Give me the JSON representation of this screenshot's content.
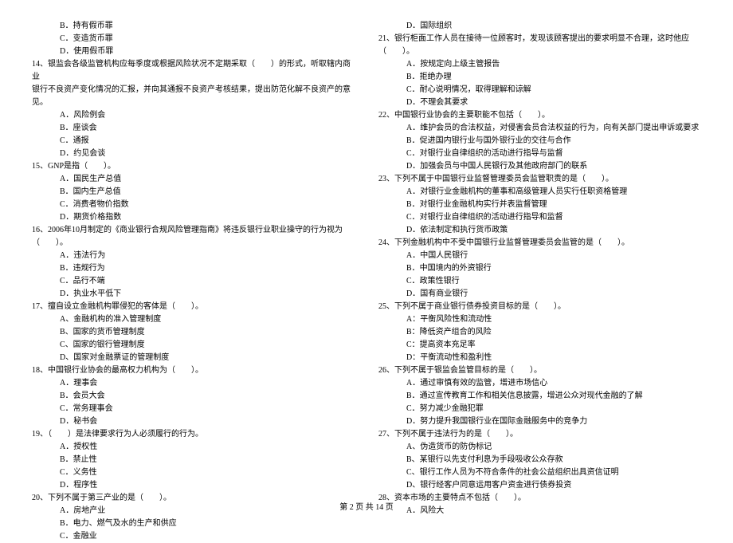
{
  "left": {
    "opts_top": [
      "B．持有假币罪",
      "C．变造货币罪",
      "D．使用假币罪"
    ],
    "q14_stem": "14、银监会各级监管机构应每季度或根据风险状况不定期采取（　　）的形式，听取辖内商业",
    "q14_stem2": "银行不良资产变化情况的汇报，并向其通报不良资产考核结果，提出防范化解不良资产的意见。",
    "q14_opts": [
      "A．风险例会",
      "B．座谈会",
      "C．通报",
      "D．约见会谈"
    ],
    "q15_stem": "15、GNP是指（　　）。",
    "q15_opts": [
      "A．国民生产总值",
      "B．国内生产总值",
      "C．消费者物价指数",
      "D．期货价格指数"
    ],
    "q16_stem": "16、2006年10月制定的《商业银行合规风险管理指南》将违反银行业职业操守的行为视为",
    "q16_stem2": "（　　）。",
    "q16_opts": [
      "A．违法行为",
      "B．违规行为",
      "C．品行不端",
      "D．执业水平低下"
    ],
    "q17_stem": "17、擅自设立金融机构罪侵犯的客体是（　　）。",
    "q17_opts": [
      "A、金融机构的准入管理制度",
      "B、国家的货币管理制度",
      "C、国家的银行管理制度",
      "D、国家对金融票证的管理制度"
    ],
    "q18_stem": "18、中国银行业协会的最高权力机构为（　　）。",
    "q18_opts": [
      "A．理事会",
      "B．会员大会",
      "C．常务理事会",
      "D．秘书会"
    ],
    "q19_stem": "19、（　　）是法律要求行为人必须履行的行为。",
    "q19_opts": [
      "A．授权性",
      "B．禁止性",
      "C．义务性",
      "D．程序性"
    ],
    "q20_stem": "20、下列不属于第三产业的是（　　）。",
    "q20_opts": [
      "A．房地产业",
      "B．电力、燃气及水的生产和供应",
      "C．金融业"
    ]
  },
  "right": {
    "opt_top": "D．国际组织",
    "q21_stem": "21、银行柜面工作人员在接待一位顾客时，发现该顾客提出的要求明显不合理，这时他应",
    "q21_stem2": "（　　）。",
    "q21_opts": [
      "A．按规定向上级主管报告",
      "B．拒绝办理",
      "C．耐心说明情况，取得理解和谅解",
      "D．不理会其要求"
    ],
    "q22_stem": "22、中国银行业协会的主要职能不包括（　　）。",
    "q22_opts": [
      "A．维护会员的合法权益，对侵害会员合法权益的行为，向有关部门提出申诉或要求",
      "B．促进国内银行业与国外银行业的交往与合作",
      "C．对银行业自律组织的活动进行指导与监督",
      "D．加强会员与中国人民银行及其他政府部门的联系"
    ],
    "q23_stem": "23、下列不属于中国银行业监督管理委员会监管职责的是（　　）。",
    "q23_opts": [
      "A．对银行业金融机构的董事和高级管理人员实行任职资格管理",
      "B．对银行业金融机构实行并表监督管理",
      "C．对银行业自律组织的活动进行指导和监督",
      "D．依法制定和执行货币政策"
    ],
    "q24_stem": "24、下列金融机构中不受中国银行业监督管理委员会监管的是（　　）。",
    "q24_opts": [
      "A．中国人民银行",
      "B．中国境内的外资银行",
      "C．政策性银行",
      "D．国有商业银行"
    ],
    "q25_stem": "25、下列不属于商业银行债券投资目标的是（　　）。",
    "q25_opts": [
      "A：平衡风险性和流动性",
      "B：降低资产组合的风险",
      "C：提高资本充足率",
      "D：平衡流动性和盈利性"
    ],
    "q26_stem": "26、下列不属于银监会监管目标的是（　　）。",
    "q26_opts": [
      "A．通过审慎有效的监管，增进市场信心",
      "B．通过宣传教育工作和相关信息披露，增进公众对现代金融的了解",
      "C．努力减少金融犯罪",
      "D．努力提升我国银行业在国际金融服务中的竞争力"
    ],
    "q27_stem": "27、下列不属于违法行为的是（　　）。",
    "q27_opts": [
      "A、伪造货币的防伪标记",
      "B、某银行以先支付利息为手段吸收公众存款",
      "C、银行工作人员为不符合条件的社会公益组织出具资信证明",
      "D、银行经客户同意运用客户资金进行债券投资"
    ],
    "q28_stem": "28、资本市场的主要特点不包括（　　）。",
    "q28_opts": [
      "A．风险大"
    ]
  },
  "footer": "第 2 页 共 14 页"
}
